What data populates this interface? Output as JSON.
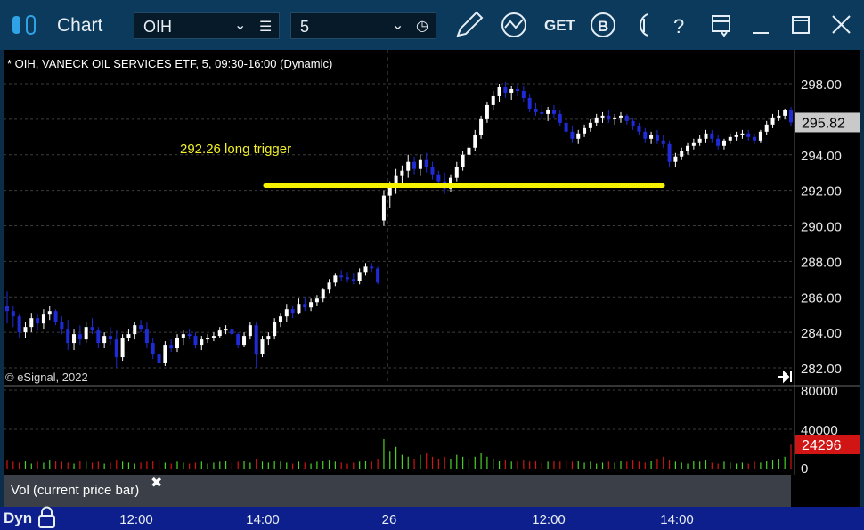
{
  "window": {
    "title": "Chart",
    "symbol": "OIH",
    "interval": "5",
    "toolbar_icons": [
      "pencil-icon",
      "study-icon",
      "get-icon",
      "b-icon",
      "t-icon",
      "help-icon",
      "layout-icon",
      "minimize-icon",
      "maximize-icon",
      "close-icon"
    ],
    "get_label": "GET",
    "b_label": "B",
    "help_label": "?"
  },
  "chart": {
    "header": "* OIH, VANECK OIL SERVICES ETF, 5, 09:30-16:00 (Dynamic)",
    "copyright": "© eSignal, 2022",
    "annotation": "292.26 long trigger",
    "last_price_label": "295.82",
    "last_volume_label": "24296",
    "status": "Dyn",
    "volume_study_label": "Vol (current price bar)",
    "close_symbol": "✖"
  },
  "chart_data": {
    "type": "candlestick",
    "price_axis": {
      "ticks": [
        "298.00",
        "296.00",
        "294.00",
        "292.00",
        "290.00",
        "288.00",
        "286.00",
        "284.00",
        "282.00"
      ],
      "range": [
        281,
        299
      ]
    },
    "volume_axis": {
      "ticks": [
        "80000",
        "40000",
        "0"
      ],
      "range": [
        0,
        80000
      ]
    },
    "x_ticks": [
      "12:00",
      "14:00",
      "26",
      "12:00",
      "14:00"
    ],
    "trigger_level": 292.26,
    "last_price": 295.82,
    "last_volume": 24296,
    "candles": [
      [
        285.5,
        286.3,
        284.5,
        285.2
      ],
      [
        285.2,
        285.5,
        284.3,
        284.9
      ],
      [
        284.9,
        285.0,
        283.7,
        284.0
      ],
      [
        284.0,
        284.6,
        283.7,
        284.3
      ],
      [
        284.3,
        285.1,
        284.0,
        284.8
      ],
      [
        284.8,
        285.0,
        284.1,
        284.5
      ],
      [
        284.5,
        285.3,
        284.2,
        285.0
      ],
      [
        285.0,
        285.5,
        284.7,
        285.2
      ],
      [
        285.2,
        285.3,
        284.4,
        284.6
      ],
      [
        284.6,
        284.9,
        283.9,
        284.2
      ],
      [
        284.2,
        284.7,
        283.0,
        283.4
      ],
      [
        283.4,
        284.2,
        283.0,
        283.9
      ],
      [
        283.9,
        284.4,
        283.3,
        283.6
      ],
      [
        283.6,
        284.6,
        283.4,
        284.3
      ],
      [
        284.3,
        284.8,
        283.9,
        284.1
      ],
      [
        284.1,
        284.3,
        283.1,
        283.4
      ],
      [
        283.4,
        284.0,
        283.1,
        283.8
      ],
      [
        283.8,
        284.3,
        283.3,
        283.6
      ],
      [
        283.6,
        284.1,
        282.0,
        282.6
      ],
      [
        282.6,
        283.9,
        282.4,
        283.7
      ],
      [
        283.7,
        284.2,
        283.5,
        283.9
      ],
      [
        283.9,
        284.6,
        283.6,
        284.4
      ],
      [
        284.4,
        284.7,
        284.0,
        284.2
      ],
      [
        284.2,
        284.6,
        283.1,
        283.4
      ],
      [
        283.4,
        283.7,
        282.5,
        282.8
      ],
      [
        282.8,
        283.1,
        282.0,
        282.3
      ],
      [
        282.3,
        283.5,
        282.1,
        283.3
      ],
      [
        283.3,
        283.6,
        282.9,
        283.1
      ],
      [
        283.1,
        283.9,
        282.9,
        283.7
      ],
      [
        283.7,
        284.1,
        283.3,
        283.9
      ],
      [
        283.9,
        284.2,
        283.6,
        283.8
      ],
      [
        283.8,
        284.0,
        283.1,
        283.3
      ],
      [
        283.3,
        283.8,
        283.0,
        283.6
      ],
      [
        283.6,
        283.9,
        283.4,
        283.7
      ],
      [
        283.7,
        284.0,
        283.5,
        283.8
      ],
      [
        283.8,
        284.3,
        283.7,
        284.1
      ],
      [
        284.1,
        284.4,
        283.9,
        284.2
      ],
      [
        284.2,
        284.4,
        283.7,
        283.9
      ],
      [
        283.9,
        284.0,
        283.1,
        283.3
      ],
      [
        283.3,
        284.0,
        283.2,
        283.8
      ],
      [
        283.8,
        284.6,
        283.6,
        284.4
      ],
      [
        284.4,
        284.6,
        282.0,
        282.8
      ],
      [
        282.8,
        283.8,
        282.6,
        283.6
      ],
      [
        283.6,
        284.0,
        283.3,
        283.8
      ],
      [
        283.8,
        284.8,
        283.6,
        284.6
      ],
      [
        284.6,
        285.1,
        284.3,
        284.9
      ],
      [
        284.9,
        285.6,
        284.6,
        285.3
      ],
      [
        285.3,
        285.5,
        284.8,
        285.1
      ],
      [
        285.1,
        285.9,
        285.0,
        285.6
      ],
      [
        285.6,
        286.0,
        285.2,
        285.4
      ],
      [
        285.4,
        285.9,
        285.2,
        285.7
      ],
      [
        285.7,
        286.1,
        285.5,
        285.9
      ],
      [
        285.9,
        286.5,
        285.7,
        286.4
      ],
      [
        286.4,
        287.0,
        286.2,
        286.8
      ],
      [
        286.8,
        287.3,
        286.6,
        287.2
      ],
      [
        287.2,
        287.5,
        286.9,
        287.1
      ],
      [
        287.1,
        287.4,
        286.8,
        287.0
      ],
      [
        287.0,
        287.3,
        286.7,
        286.9
      ],
      [
        286.9,
        287.6,
        286.7,
        287.4
      ],
      [
        287.4,
        287.9,
        287.2,
        287.7
      ],
      [
        287.7,
        287.9,
        287.4,
        287.6
      ],
      [
        287.6,
        287.7,
        286.7,
        286.8
      ],
      [
        290.3,
        292.0,
        290.0,
        291.7
      ],
      [
        291.7,
        292.5,
        291.0,
        292.3
      ],
      [
        292.3,
        293.2,
        291.8,
        292.8
      ],
      [
        292.8,
        293.4,
        292.4,
        293.1
      ],
      [
        293.1,
        294.0,
        292.7,
        293.6
      ],
      [
        293.6,
        293.9,
        292.9,
        293.2
      ],
      [
        293.2,
        294.0,
        292.8,
        293.7
      ],
      [
        293.7,
        294.1,
        293.0,
        293.3
      ],
      [
        293.3,
        293.6,
        292.6,
        292.9
      ],
      [
        292.9,
        293.1,
        292.2,
        292.5
      ],
      [
        292.5,
        293.0,
        291.8,
        292.1
      ],
      [
        292.1,
        292.9,
        291.9,
        292.7
      ],
      [
        292.7,
        293.6,
        292.5,
        293.3
      ],
      [
        293.3,
        294.2,
        293.1,
        294.0
      ],
      [
        294.0,
        294.6,
        293.8,
        294.4
      ],
      [
        294.4,
        295.4,
        294.2,
        295.1
      ],
      [
        295.1,
        296.2,
        294.9,
        296.0
      ],
      [
        296.0,
        297.0,
        295.8,
        296.8
      ],
      [
        296.8,
        297.6,
        296.5,
        297.3
      ],
      [
        297.3,
        298.0,
        297.0,
        297.8
      ],
      [
        297.8,
        298.1,
        297.2,
        297.5
      ],
      [
        297.5,
        297.9,
        297.1,
        297.7
      ],
      [
        297.7,
        298.0,
        297.3,
        297.6
      ],
      [
        297.6,
        297.9,
        297.0,
        297.2
      ],
      [
        297.2,
        297.4,
        296.4,
        296.6
      ],
      [
        296.6,
        296.9,
        296.2,
        296.4
      ],
      [
        296.4,
        296.8,
        296.0,
        296.3
      ],
      [
        296.3,
        296.7,
        295.9,
        296.5
      ],
      [
        296.5,
        296.8,
        296.1,
        296.3
      ],
      [
        296.3,
        296.5,
        295.6,
        295.8
      ],
      [
        295.8,
        296.0,
        295.1,
        295.3
      ],
      [
        295.3,
        295.6,
        294.7,
        294.9
      ],
      [
        294.9,
        295.4,
        294.6,
        295.2
      ],
      [
        295.2,
        295.7,
        295.0,
        295.5
      ],
      [
        295.5,
        296.0,
        295.3,
        295.8
      ],
      [
        295.8,
        296.3,
        295.6,
        296.1
      ],
      [
        296.1,
        296.4,
        295.8,
        296.2
      ],
      [
        296.2,
        296.5,
        295.8,
        296.0
      ],
      [
        296.0,
        296.3,
        295.7,
        296.1
      ],
      [
        296.1,
        296.4,
        295.8,
        296.2
      ],
      [
        296.2,
        296.3,
        295.7,
        295.9
      ],
      [
        295.9,
        296.1,
        295.4,
        295.6
      ],
      [
        295.6,
        295.8,
        295.1,
        295.3
      ],
      [
        295.3,
        295.5,
        294.7,
        294.9
      ],
      [
        294.9,
        295.3,
        294.6,
        295.1
      ],
      [
        295.1,
        295.4,
        294.6,
        294.8
      ],
      [
        294.8,
        295.1,
        294.4,
        294.6
      ],
      [
        294.6,
        294.8,
        293.3,
        293.6
      ],
      [
        293.6,
        294.1,
        293.3,
        293.9
      ],
      [
        293.9,
        294.4,
        293.7,
        294.2
      ],
      [
        294.2,
        294.7,
        294.0,
        294.5
      ],
      [
        294.5,
        294.9,
        294.3,
        294.7
      ],
      [
        294.7,
        295.1,
        294.5,
        294.9
      ],
      [
        294.9,
        295.4,
        294.7,
        295.2
      ],
      [
        295.2,
        295.4,
        294.7,
        294.9
      ],
      [
        294.9,
        295.1,
        294.3,
        294.5
      ],
      [
        294.5,
        294.9,
        294.3,
        294.8
      ],
      [
        294.8,
        295.2,
        294.6,
        295.0
      ],
      [
        295.0,
        295.3,
        294.8,
        295.1
      ],
      [
        295.1,
        295.4,
        294.9,
        295.2
      ],
      [
        295.2,
        295.4,
        294.8,
        295.0
      ],
      [
        295.0,
        295.2,
        294.6,
        294.8
      ],
      [
        294.8,
        295.4,
        294.7,
        295.3
      ],
      [
        295.3,
        295.9,
        295.1,
        295.7
      ],
      [
        295.7,
        296.3,
        295.5,
        296.1
      ],
      [
        296.1,
        296.5,
        295.9,
        296.2
      ],
      [
        296.2,
        296.6,
        296.0,
        296.5
      ],
      [
        296.5,
        296.7,
        295.6,
        295.82
      ]
    ],
    "volumes": [
      9000,
      7000,
      6000,
      8000,
      5000,
      7000,
      6000,
      9000,
      8000,
      7000,
      6000,
      5000,
      8000,
      7000,
      6000,
      7000,
      5000,
      6000,
      9000,
      7000,
      6000,
      5000,
      6000,
      7000,
      8000,
      9000,
      6000,
      5000,
      7000,
      6000,
      5000,
      6000,
      7000,
      5000,
      6000,
      7000,
      8000,
      6000,
      7000,
      8000,
      6000,
      10000,
      7000,
      6000,
      8000,
      7000,
      6000,
      5000,
      7000,
      6000,
      5000,
      7000,
      8000,
      9000,
      7000,
      6000,
      5000,
      6000,
      7000,
      8000,
      7000,
      10000,
      30000,
      18000,
      22000,
      14000,
      12000,
      10000,
      14000,
      16000,
      12000,
      10000,
      12000,
      10000,
      14000,
      12000,
      10000,
      12000,
      16000,
      12000,
      10000,
      8000,
      9000,
      7000,
      8000,
      9000,
      7000,
      8000,
      6000,
      7000,
      8000,
      7000,
      9000,
      7000,
      8000,
      6000,
      7000,
      5000,
      6000,
      7000,
      6000,
      8000,
      7000,
      9000,
      7000,
      6000,
      8000,
      10000,
      12000,
      9000,
      7000,
      6000,
      5000,
      8000,
      7000,
      9000,
      6000,
      5000,
      7000,
      6000,
      5000,
      6000,
      5000,
      7000,
      6000,
      8000,
      9000,
      10000,
      12000,
      24296
    ]
  }
}
